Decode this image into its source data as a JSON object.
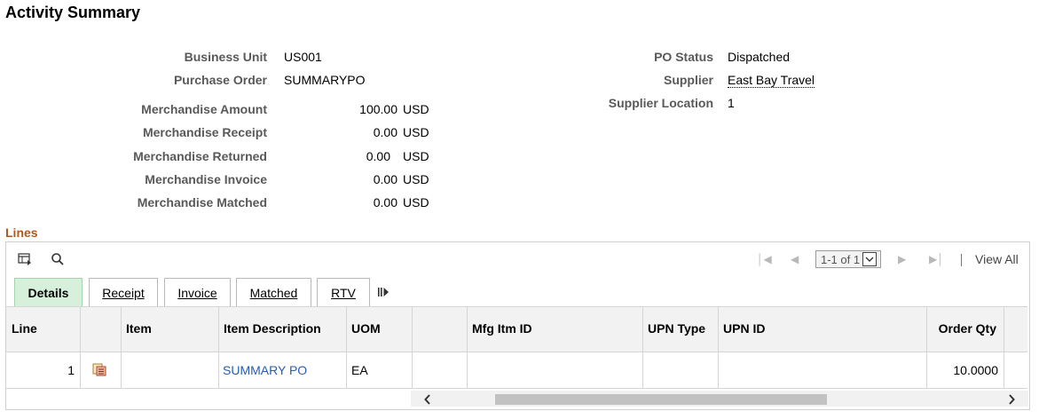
{
  "page_title": "Activity Summary",
  "header": {
    "business_unit_label": "Business Unit",
    "business_unit_value": "US001",
    "purchase_order_label": "Purchase Order",
    "purchase_order_value": "SUMMARYPO",
    "po_status_label": "PO Status",
    "po_status_value": "Dispatched",
    "supplier_label": "Supplier",
    "supplier_value": "East Bay Travel",
    "supplier_location_label": "Supplier Location",
    "supplier_location_value": "1"
  },
  "amounts": [
    {
      "label": "Merchandise Amount",
      "value": "100.00",
      "currency": "USD"
    },
    {
      "label": "Merchandise Receipt",
      "value": "0.00",
      "currency": "USD"
    },
    {
      "label": "Merchandise Returned",
      "value": "0.00",
      "currency": "USD"
    },
    {
      "label": "Merchandise Invoice",
      "value": "0.00",
      "currency": "USD"
    },
    {
      "label": "Merchandise Matched",
      "value": "0.00",
      "currency": "USD"
    }
  ],
  "lines": {
    "title": "Lines",
    "pager_text": "1-1 of 1",
    "view_all": "View All",
    "tabs": [
      "Details",
      "Receipt",
      "Invoice",
      "Matched",
      "RTV"
    ],
    "columns": [
      "Line",
      "",
      "Item",
      "Item Description",
      "UOM",
      "",
      "Mfg Itm ID",
      "UPN Type",
      "UPN ID",
      "Order Qty"
    ],
    "rows": [
      {
        "line": "1",
        "item": "",
        "description": "SUMMARY PO",
        "uom": "EA",
        "mfg_itm_id": "",
        "upn_type": "",
        "upn_id": "",
        "order_qty": "10.0000"
      }
    ]
  },
  "colors": {
    "accent_link": "#2a5db0",
    "section_title": "#b2561c",
    "active_tab": "#d6f0dc"
  },
  "icons": [
    "grid-personalize-icon",
    "search-icon",
    "first-page-icon",
    "previous-page-icon",
    "chevron-down-icon",
    "next-page-icon",
    "last-page-icon",
    "more-tabs-icon",
    "line-details-icon",
    "scroll-left-icon",
    "scroll-right-icon"
  ]
}
